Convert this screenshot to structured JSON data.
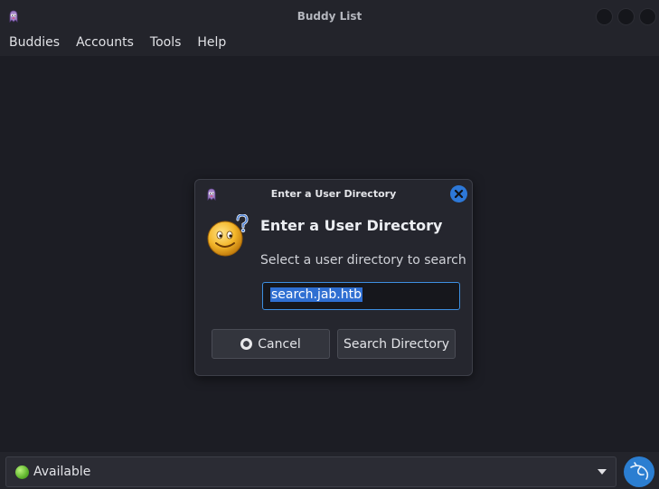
{
  "window": {
    "title": "Buddy List"
  },
  "menu": [
    "Buddies",
    "Accounts",
    "Tools",
    "Help"
  ],
  "dialog": {
    "title": "Enter a User Directory",
    "heading": "Enter a User Directory",
    "description": "Select a user directory to search",
    "input_value": "search.jab.htb",
    "cancel_label": "Cancel",
    "search_label": "Search Directory"
  },
  "status": {
    "label": "Available"
  },
  "colors": {
    "accent": "#2d78d8",
    "selection": "#2f6fd2",
    "status_green": "#5fb52d"
  },
  "icons": [
    "pidgin-icon",
    "close-icon",
    "smiley-question-icon",
    "radio-icon",
    "status-available-icon",
    "chevron-down-icon",
    "kali-dragon-icon"
  ]
}
